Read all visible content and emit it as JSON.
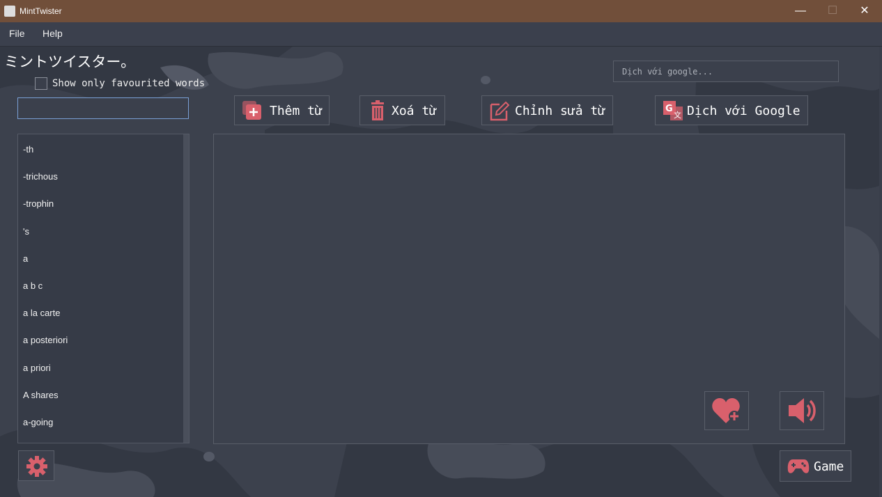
{
  "window": {
    "title": "MintTwister",
    "minimize": "—",
    "maximize": "☐",
    "close": "✕"
  },
  "menu": [
    "File",
    "Help"
  ],
  "app_title": "ミントツイスター。",
  "favourite_filter": {
    "label": "Show only favourited words",
    "checked": false
  },
  "search": {
    "value": ""
  },
  "google_search": {
    "placeholder": "Dịch với google..."
  },
  "toolbar": {
    "add_label": "Thêm từ",
    "delete_label": "Xoá từ",
    "edit_label": "Chỉnh sửa từ",
    "translate_label": "Dịch với Google"
  },
  "word_list": [
    "-th",
    "-trichous",
    "-trophin",
    "'s",
    "a",
    "a b c",
    "a la carte",
    "a posteriori",
    "a priori",
    "A shares",
    "a-going"
  ],
  "game_label": "Game",
  "colors": {
    "accent": "#d9606c",
    "titlebar": "#714f3a",
    "panel": "#3b404c"
  },
  "icons": [
    "settings-gear-icon",
    "heart-plus-icon",
    "speaker-icon",
    "gamepad-icon",
    "add-square-icon",
    "trash-icon",
    "edit-icon",
    "google-translate-icon"
  ]
}
